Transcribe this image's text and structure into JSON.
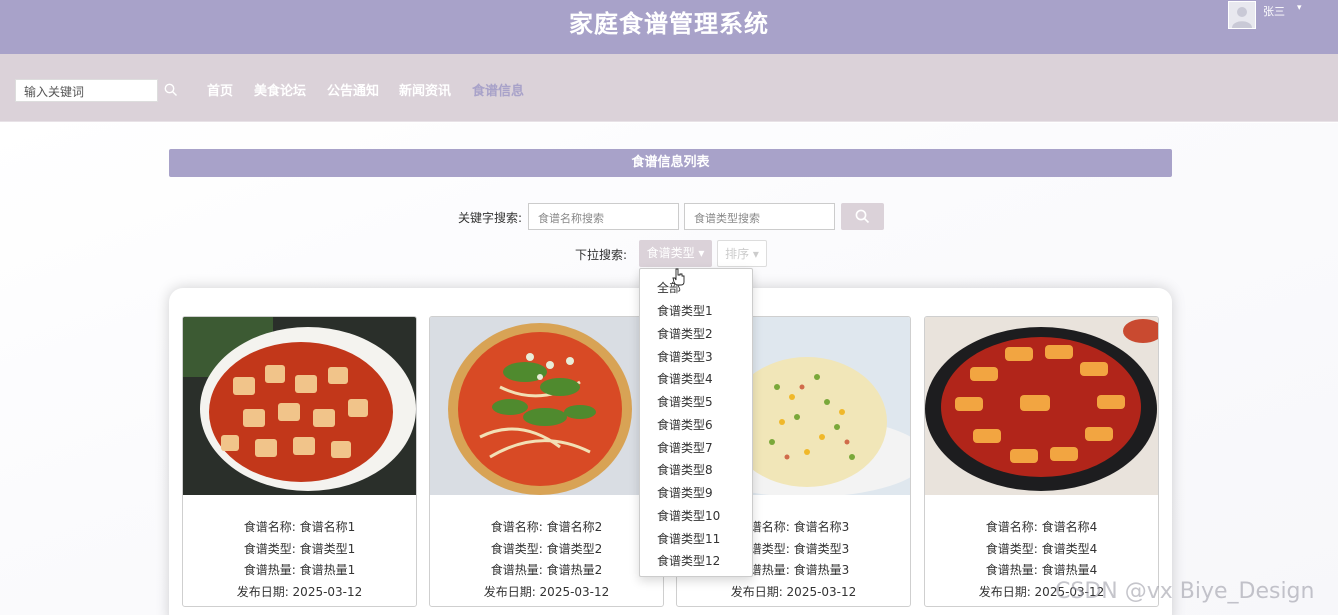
{
  "header": {
    "title": "家庭食谱管理系统",
    "username": "张三",
    "caret": "▾"
  },
  "navbar": {
    "search_placeholder": "输入关键词",
    "items": [
      {
        "label": "首页",
        "active": false
      },
      {
        "label": "美食论坛",
        "active": false
      },
      {
        "label": "公告通知",
        "active": false
      },
      {
        "label": "新闻资讯",
        "active": false
      },
      {
        "label": "食谱信息",
        "active": true
      }
    ]
  },
  "list": {
    "title": "食谱信息列表",
    "keyword_label": "关键字搜索:",
    "name_placeholder": "食谱名称搜索",
    "type_placeholder": "食谱类型搜索",
    "dropdown_label": "下拉搜索:",
    "type_button": "食谱类型 ▾",
    "sort_button": "排序 ▾"
  },
  "dropdown_menu": [
    "全部",
    "食谱类型1",
    "食谱类型2",
    "食谱类型3",
    "食谱类型4",
    "食谱类型5",
    "食谱类型6",
    "食谱类型7",
    "食谱类型8",
    "食谱类型9",
    "食谱类型10",
    "食谱类型11",
    "食谱类型12"
  ],
  "cards": [
    {
      "name": "食谱名称: 食谱名称1",
      "type": "食谱类型: 食谱类型1",
      "calories": "食谱热量: 食谱热量1",
      "date": "发布日期: 2025-03-12"
    },
    {
      "name": "食谱名称: 食谱名称2",
      "type": "食谱类型: 食谱类型2",
      "calories": "食谱热量: 食谱热量2",
      "date": "发布日期: 2025-03-12"
    },
    {
      "name": "食谱名称: 食谱名称3",
      "type": "食谱类型: 食谱类型3",
      "calories": "食谱热量: 食谱热量3",
      "date": "发布日期: 2025-03-12"
    },
    {
      "name": "食谱名称: 食谱名称4",
      "type": "食谱类型: 食谱类型4",
      "calories": "食谱热量: 食谱热量4",
      "date": "发布日期: 2025-03-12"
    }
  ],
  "watermark": "CSDN @vx Biye_Design",
  "colors": {
    "primary": "#a8a2c9",
    "nav_bg": "#dbd2d9"
  }
}
